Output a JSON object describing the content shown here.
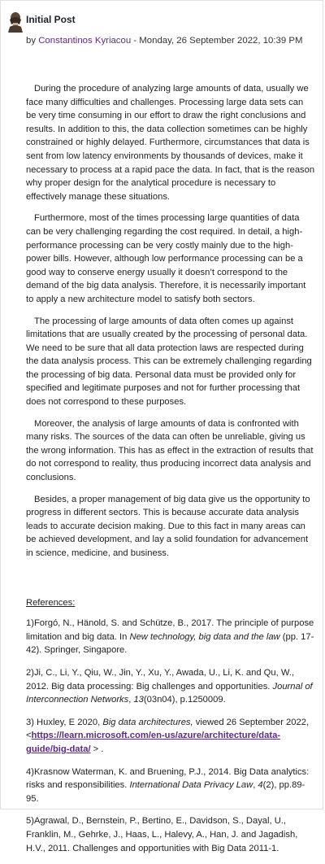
{
  "post": {
    "title": "Initial Post",
    "by_prefix": "by ",
    "author": "Constantinos Kyriacou",
    "date": " - Monday, 26 September 2022, 10:39 PM"
  },
  "paragraphs": [
    "During the procedure of analyzing large amounts of data, usually we face many difficulties and challenges. Processing large data sets can be very time consuming in our effort to draw the right conclusions and results. In addition to this, the data collection sometimes can be highly constrained or highly delayed. Furthermore, circumstances that data is sent from low latency environments by thousands of devices, make it necessary to process at a rapid pace the data. In fact, that is the reason why proper design for the analytical procedure is necessary to effectively manage these situations.",
    "Furthermore, most of the times processing large quantities of data can be very challenging regarding the cost required. In detail, a high-performance processing can be very costly mainly due to the high-power bills. However, although low performance processing can be a good way to conserve energy usually it doesn’t correspond to the demand of the big data analysis. Therefore, it is necessarily important to apply a new architecture model to satisfy both sectors.",
    "The processing of large amounts of data often comes up against limitations that are usually created by the processing of personal data. We need to be sure that all data protection laws are respected during the data analysis process. This can be extremely challenging regarding the processing of big data. Personal data must be provided only for specified and legitimate purposes and not for further processing that does not correspond to these purposes.",
    "Moreover, the analysis of large amounts of data is confronted with many risks. The sources of the data can often be unreliable, giving us the wrong information. This has as effect in the extraction of results that do not correspond to reality, thus producing incorrect data analysis and conclusions.",
    "Besides, a proper management of big data give us the opportunity to progress in different sectors. This is because accurate data analysis leads to accurate decision making. Due to this fact in many areas can be achieved development, and lay a solid foundation for advancement in science, medicine, and business."
  ],
  "references": {
    "title": "References:",
    "r1_a": "1)Forgó, N., Hänold, S. and Schütze, B., 2017. The principle of purpose limitation and big data. In ",
    "r1_em": "New technology, big data and the law",
    "r1_b": " (pp. 17-42). Springer, Singapore.",
    "r2_a": "2)Ji, C., Li, Y., Qiu, W., Jin, Y., Xu, Y., Awada, U., Li, K. and Qu, W., 2012. Big data processing: Big challenges and opportunities. ",
    "r2_em": "Journal of Interconnection Networks",
    "r2_b": ", ",
    "r2_em2": "13",
    "r2_c": "(03n04), p.1250009.",
    "r3_a": "3) Huxley, E 2020, ",
    "r3_em": "Big data architectures,",
    "r3_b": " viewed 26 September 2022, <",
    "r3_link": "https://learn.microsoft.com/en-us/azure/architecture/data-guide/big-data/",
    "r3_c": " > .",
    "r4_a": "4)Krasnow Waterman, K. and Bruening, P.J., 2014. Big Data analytics: risks and responsibilities. ",
    "r4_em": "International Data Privacy Law",
    "r4_b": ", ",
    "r4_em2": "4",
    "r4_c": "(2), pp.89-95.",
    "r5": "5)Agrawal, D., Bernstein, P., Bertino, E., Davidson, S., Dayal, U., Franklin, M., Gehrke, J., Haas, L., Halevy, A., Han, J. and Jagadish, H.V., 2011. Challenges and opportunities with Big Data 2011-1."
  }
}
